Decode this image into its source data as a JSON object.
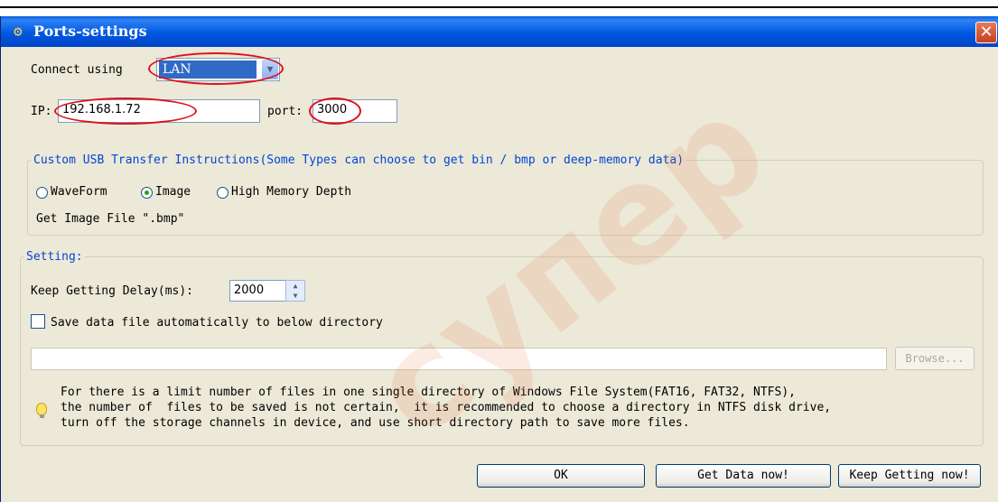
{
  "window": {
    "title": "Ports-settings",
    "close_glyph": "✕"
  },
  "connection": {
    "connect_label": "Connect using",
    "connect_value": "LAN",
    "ip_label": "IP:",
    "ip_value": "192.168.1.72",
    "port_label": "port:",
    "port_value": "3000"
  },
  "usb_group": {
    "legend": "Custom USB Transfer Instructions(Some Types can choose to get bin / bmp or deep-memory data)",
    "options": [
      "WaveForm",
      "Image",
      "High Memory Depth"
    ],
    "selected": "Image",
    "file_info": "Get Image File \".bmp\""
  },
  "setting_group": {
    "legend": "Setting:",
    "delay_label": "Keep Getting Delay(ms):",
    "delay_value": "2000",
    "save_checkbox_label": "Save data file automatically to below directory",
    "save_checked": false,
    "directory_value": "",
    "browse_label": "Browse...",
    "note": "For there is a limit number of files in one single directory of Windows File System(FAT16, FAT32, NTFS),\nthe number of  files to be saved is not certain,  it is recommended to choose a directory in NTFS disk drive,\nturn off the storage channels in device, and use short directory path to save more files."
  },
  "buttons": {
    "ok": "OK",
    "get_data": "Get Data now!",
    "keep_getting": "Keep Getting now!"
  },
  "watermark": "супер",
  "colors": {
    "titlebar": "#0058e0",
    "legend": "#0046d5",
    "highlight_ellipse": "#e0101a",
    "selection": "#316ac5"
  },
  "icons": [
    "gears-icon",
    "close-icon",
    "dropdown-arrow-icon",
    "spin-up-icon",
    "spin-down-icon",
    "lightbulb-icon"
  ]
}
